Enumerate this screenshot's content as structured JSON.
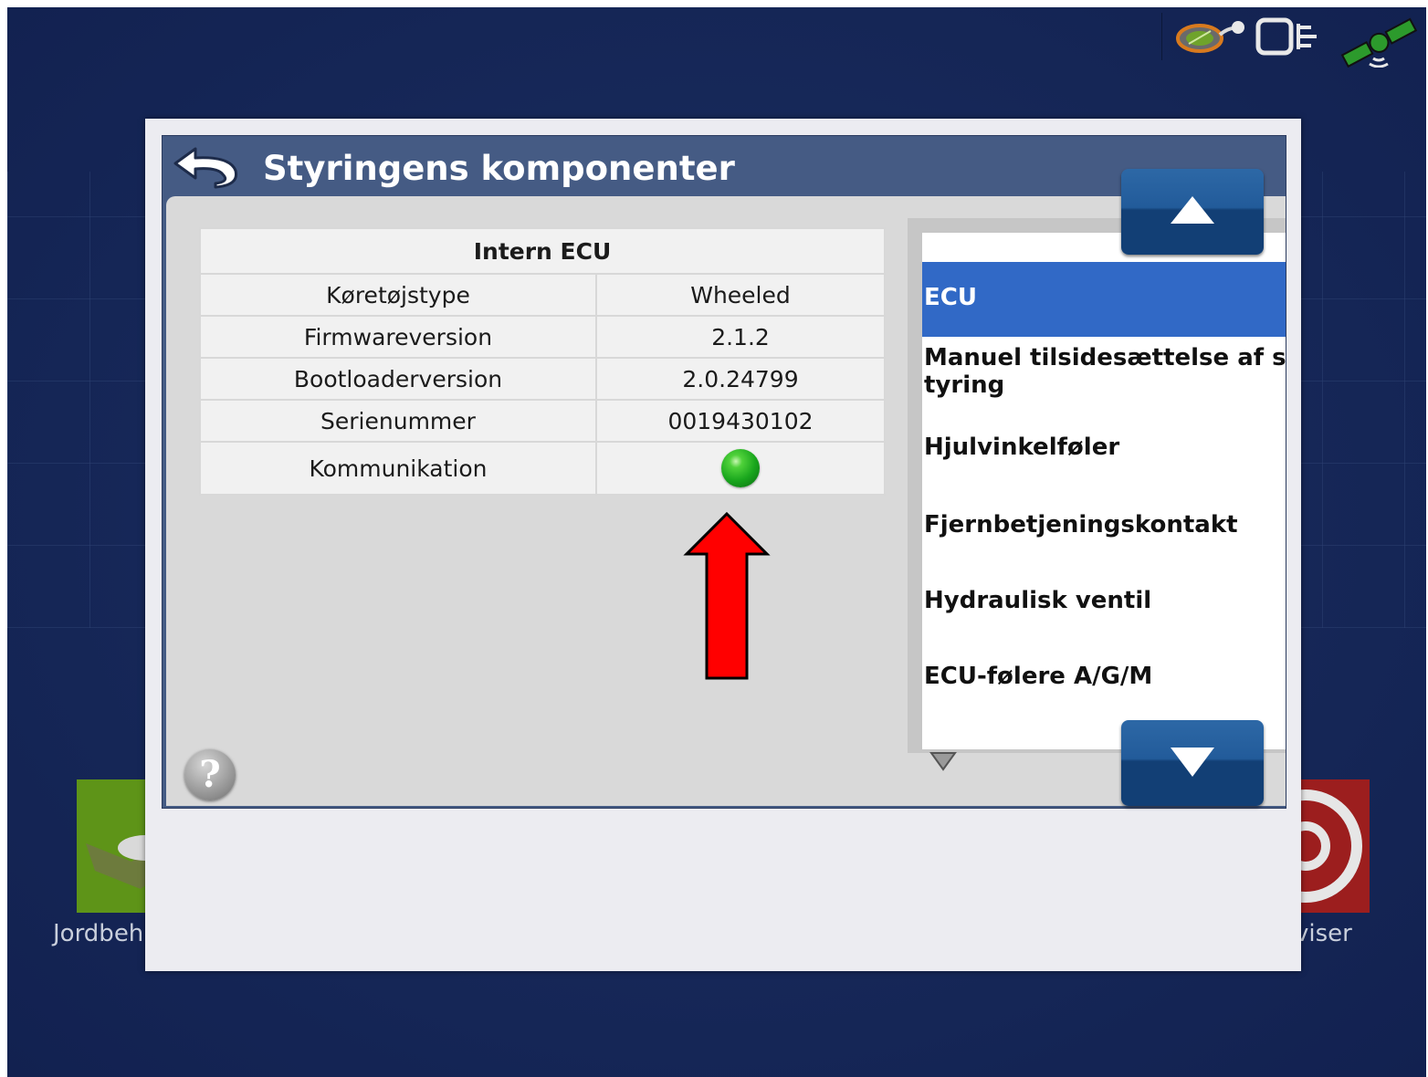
{
  "dialog": {
    "title": "Styringens komponenter"
  },
  "ecu_table": {
    "header": "Intern ECU",
    "rows": [
      {
        "label": "Køretøjstype",
        "value": "Wheeled"
      },
      {
        "label": "Firmwareversion",
        "value": "2.1.2"
      },
      {
        "label": "Bootloaderversion",
        "value": "2.0.24799"
      },
      {
        "label": "Serienummer",
        "value": "0019430102"
      },
      {
        "label": "Kommunikation",
        "status": "ok",
        "status_color": "#1ea51f"
      }
    ]
  },
  "component_list": {
    "items": [
      {
        "label": "ECU",
        "selected": true
      },
      {
        "label": "Manuel tilsidesættelse af s",
        "label_line2": "tyring"
      },
      {
        "label": "Hjulvinkelføler"
      },
      {
        "label": "Fjernbetjeningskontakt"
      },
      {
        "label": "Hydraulisk ventil"
      },
      {
        "label": "ECU-følere A/G/M"
      }
    ]
  },
  "background_apps": {
    "left_label": "Jordbeh",
    "right_label": "viser"
  },
  "annotation": {
    "arrow_color": "#ff0000"
  },
  "colors": {
    "accent_selection": "#3169c6",
    "nav_button": "#225b9a",
    "title_bar": "#455b84"
  },
  "icons": [
    "back-arrow-icon",
    "help-icon",
    "scroll-up-icon",
    "scroll-down-icon",
    "field-map-icon",
    "ecu-module-icon",
    "gps-satellite-icon"
  ]
}
